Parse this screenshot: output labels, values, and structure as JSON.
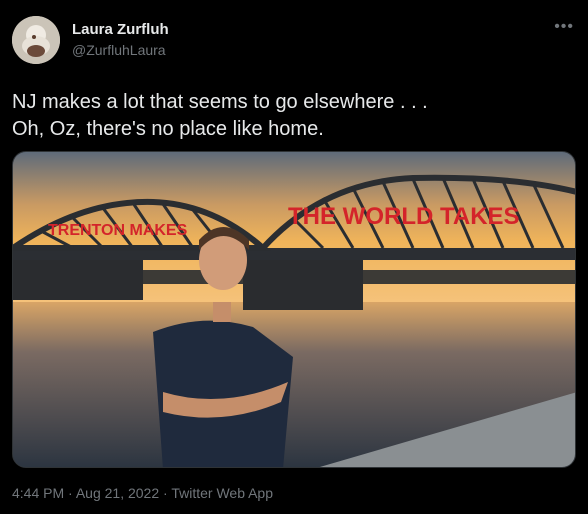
{
  "tweet": {
    "author_name": "Laura Zurfluh",
    "author_handle": "@ZurfluhLaura",
    "more_icon": "more-options-icon",
    "text": "NJ makes a lot that seems to go elsewhere . . .\nOh, Oz, there's no place like home.",
    "media": {
      "sign_left": "TRENTON MAKES",
      "sign_right": "THE WORLD TAKES"
    },
    "time": "4:44 PM",
    "date": "Aug 21, 2022",
    "source": "Twitter Web App",
    "separator": "·"
  },
  "colors": {
    "background": "#000000",
    "text_primary": "#e7e9ea",
    "text_secondary": "#71767b",
    "sign_red": "#d4242a"
  }
}
